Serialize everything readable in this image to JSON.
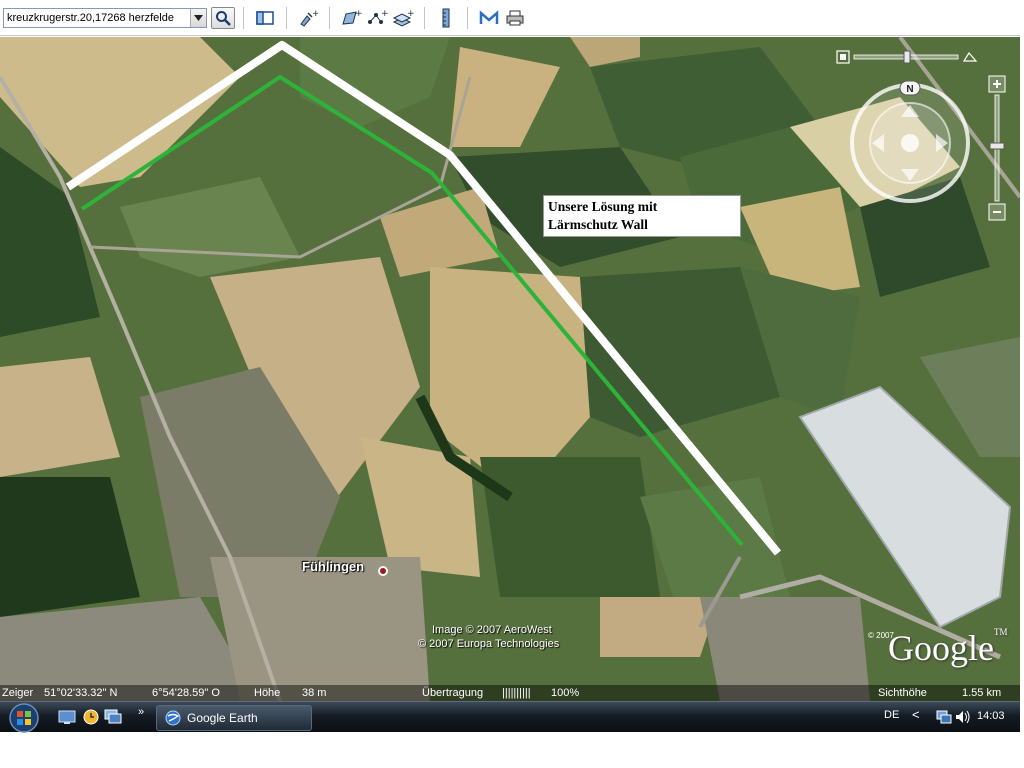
{
  "toolbar": {
    "search_value": "kreuzkrugerstr.20,17268 herzfelde",
    "icons": [
      "dropdown-arrow-icon",
      "search-icon",
      "sidebar-toggle-icon",
      "add-placemark-icon",
      "add-polygon-icon",
      "add-path-icon",
      "add-image-overlay-icon",
      "ruler-icon",
      "email-icon",
      "print-icon"
    ]
  },
  "map": {
    "annotation_lines": [
      "Unsere Lösung mit",
      "Lärmschutz Wall"
    ],
    "place_label": "Fühlingen",
    "credits": [
      "Image © 2007 AeroWest",
      "© 2007 Europa Technologies"
    ],
    "google_copyright": "© 2007",
    "google_logo": "Google",
    "google_tm": "TM",
    "compass_label": "N",
    "route_colors": {
      "proposed": "#2db33a",
      "wall": "#ffffff"
    }
  },
  "status": {
    "pointer_label": "Zeiger",
    "latitude": "51°02'33.32\" N",
    "longitude": "6°54'28.59\" O",
    "elevation_label": "Höhe",
    "elevation_value": "38 m",
    "transfer_label": "Übertragung",
    "transfer_bar": "||||||||||",
    "transfer_percent": "100%",
    "view_height_label": "Sichthöhe",
    "view_height_value": "1.55 km"
  },
  "taskbar": {
    "app_button": "Google Earth",
    "more_symbol": "»",
    "language": "DE",
    "tray_chevron": "<",
    "time": "14:03"
  }
}
